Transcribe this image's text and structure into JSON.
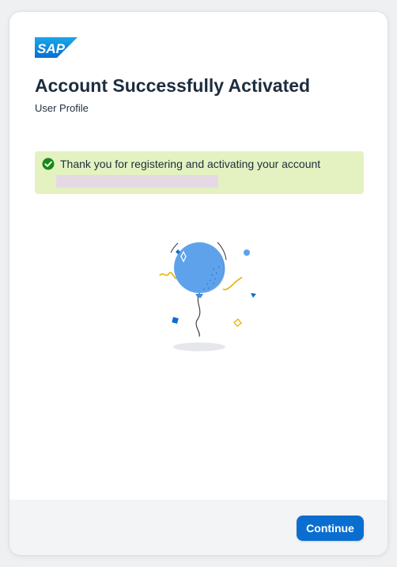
{
  "brand": {
    "logo_text": "SAP",
    "logo_color": "#0a6ed1"
  },
  "header": {
    "title": "Account Successfully Activated",
    "subtitle": "User Profile"
  },
  "message_strip": {
    "type": "success",
    "icon": "success-check-icon",
    "text": "Thank you for registering and activating your account",
    "background": "#e3f2c0",
    "icon_color": "#188918"
  },
  "illustration": {
    "name": "balloon-celebration-illustration"
  },
  "footer": {
    "continue_label": "Continue",
    "button_color": "#0a6ed1"
  }
}
